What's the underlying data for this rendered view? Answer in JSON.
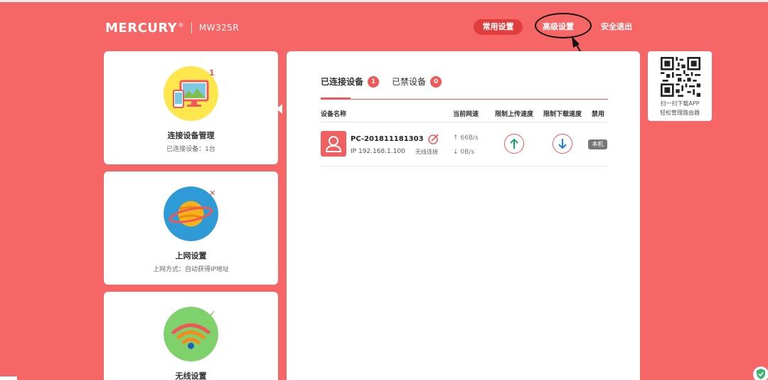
{
  "brand": {
    "logo": "MERCURY",
    "trademark": "®",
    "model": "MW325R"
  },
  "nav": {
    "common_settings": "常用设置",
    "advanced_settings": "高级设置",
    "logout": "安全退出"
  },
  "cards": [
    {
      "title": "连接设备管理",
      "subtitle": "已连接设备：1台",
      "badge": "1",
      "badge_color": "#f25757",
      "icon": "monitor-devices-icon"
    },
    {
      "title": "上网设置",
      "subtitle": "上网方式：自动获得IP地址",
      "badge": "✕",
      "badge_color": "#e84848",
      "icon": "planet-icon"
    },
    {
      "title": "无线设置",
      "subtitle": "",
      "badge": "✓",
      "badge_color": "#52c41a",
      "icon": "wifi-icon"
    }
  ],
  "panel": {
    "tabs": [
      {
        "label": "已连接设备",
        "count": "1"
      },
      {
        "label": "已禁设备",
        "count": "0"
      }
    ],
    "columns": [
      "设备名称",
      "当前网速",
      "限制上传速度",
      "限制下载速度",
      "禁用"
    ],
    "devices": [
      {
        "name": "PC-201811181303",
        "ip": "IP 192.168.1.100",
        "connection": "无线连接",
        "upload_speed": "66B/s",
        "download_speed": "0B/s",
        "badge": "本机"
      }
    ]
  },
  "qr": {
    "line1": "扫一扫下载APP",
    "line2": "轻松管理路由器"
  },
  "colors": {
    "background": "#f76666",
    "accent": "#f25757",
    "nav_active": "#e03e3e"
  }
}
